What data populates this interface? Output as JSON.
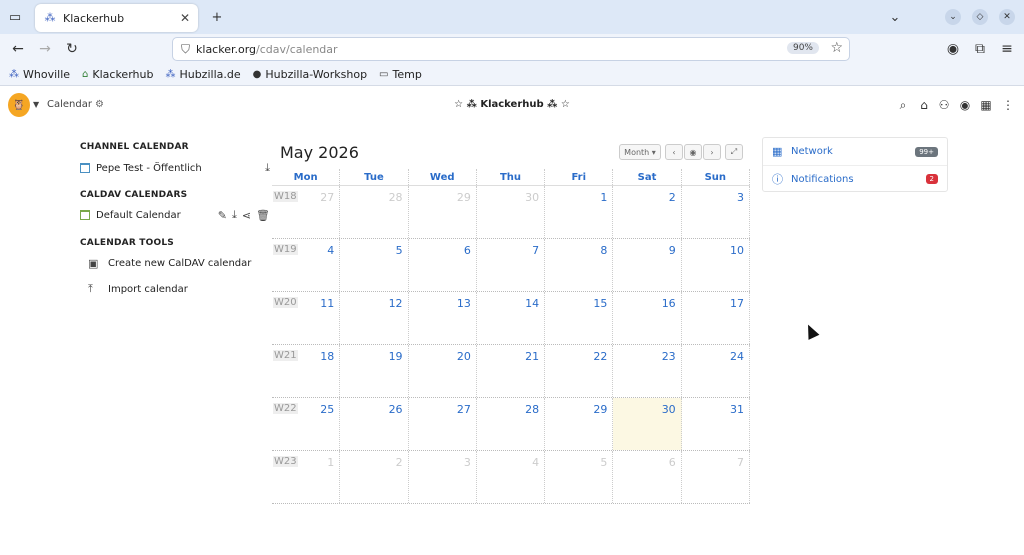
{
  "browser": {
    "tab_title": "Klackerhub",
    "url_host": "klacker.org",
    "url_path": "/cdav/calendar",
    "zoom": "90%",
    "bookmarks": [
      "Whoville",
      "Klackerhub",
      "Hubzilla.de",
      "Hubzilla-Workshop",
      "Temp"
    ]
  },
  "app": {
    "section": "Calendar",
    "site_name": "☆ ⁂ Klackerhub ⁂ ☆"
  },
  "sidebar": {
    "channel_heading": "CHANNEL CALENDAR",
    "channel_calendar": "Pepe Test - Öffentlich",
    "caldav_heading": "CALDAV CALENDARS",
    "caldav_calendar": "Default Calendar",
    "tools_heading": "CALENDAR TOOLS",
    "create_label": "Create new CalDAV calendar",
    "import_label": "Import calendar"
  },
  "calendar": {
    "title": "May 2026",
    "view_label": "Month",
    "days": [
      "Mon",
      "Tue",
      "Wed",
      "Thu",
      "Fri",
      "Sat",
      "Sun"
    ],
    "weeks": [
      {
        "label": "W18",
        "days": [
          27,
          28,
          29,
          30,
          1,
          2,
          3
        ]
      },
      {
        "label": "W19",
        "days": [
          4,
          5,
          6,
          7,
          8,
          9,
          10
        ]
      },
      {
        "label": "W20",
        "days": [
          11,
          12,
          13,
          14,
          15,
          16,
          17
        ]
      },
      {
        "label": "W21",
        "days": [
          18,
          19,
          20,
          21,
          22,
          23,
          24
        ]
      },
      {
        "label": "W22",
        "days": [
          25,
          26,
          27,
          28,
          29,
          30,
          31
        ]
      },
      {
        "label": "W23",
        "days": [
          1,
          2,
          3,
          4,
          5,
          6,
          7
        ]
      }
    ],
    "today": 30
  },
  "widgets": {
    "network_label": "Network",
    "network_badge": "99+",
    "notifications_label": "Notifications",
    "notifications_badge": "2"
  }
}
